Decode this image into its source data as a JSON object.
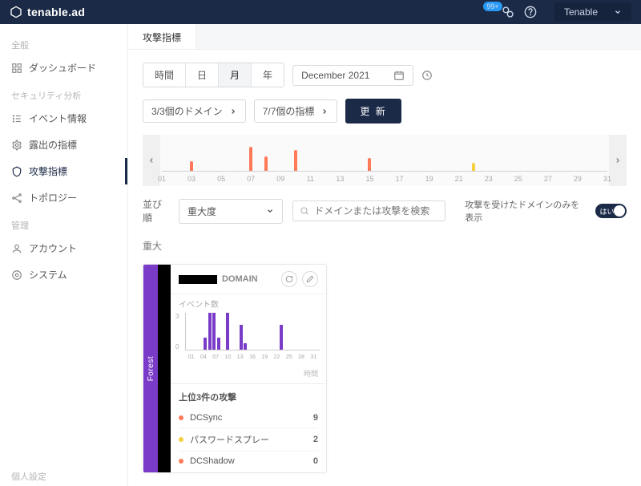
{
  "product": "tenable.ad",
  "badge": "99+",
  "tenant": "Tenable",
  "sidebar": {
    "groups": [
      {
        "label": "全般",
        "items": [
          {
            "label": "ダッシュボード",
            "icon": "grid"
          }
        ]
      },
      {
        "label": "セキュリティ分析",
        "items": [
          {
            "label": "イベント情報",
            "icon": "list"
          },
          {
            "label": "露出の指標",
            "icon": "gear"
          },
          {
            "label": "攻撃指標",
            "icon": "shield",
            "active": true
          },
          {
            "label": "トポロジー",
            "icon": "topology"
          }
        ]
      },
      {
        "label": "管理",
        "items": [
          {
            "label": "アカウント",
            "icon": "user"
          },
          {
            "label": "システム",
            "icon": "circle"
          }
        ]
      },
      {
        "label": "個人設定",
        "items": []
      }
    ]
  },
  "tab": "攻撃指標",
  "time_btns": [
    "時間",
    "日",
    "月",
    "年"
  ],
  "time_selected": "月",
  "date_value": "December 2021",
  "domain_chip": "3/3個のドメイン",
  "indicator_chip": "7/7個の指標",
  "update_btn": "更 新",
  "timeline": {
    "ticks": [
      "01",
      "03",
      "05",
      "07",
      "09",
      "11",
      "13",
      "15",
      "17",
      "19",
      "21",
      "23",
      "25",
      "27",
      "29",
      "31"
    ],
    "bars": [
      {
        "day": 3,
        "h": 12,
        "color": "#ff7a59"
      },
      {
        "day": 7,
        "h": 30,
        "color": "#ff7a59"
      },
      {
        "day": 8,
        "h": 18,
        "color": "#ff7a59"
      },
      {
        "day": 10,
        "h": 26,
        "color": "#ff7a59"
      },
      {
        "day": 15,
        "h": 16,
        "color": "#ff7a59"
      },
      {
        "day": 22,
        "h": 10,
        "color": "#f4d03f"
      }
    ]
  },
  "sort_label": "並び順",
  "sort_value": "重大度",
  "search_placeholder": "ドメインまたは攻撃を検索",
  "attacked_only_label": "攻撃を受けたドメインのみを表示",
  "toggle_text": "はい",
  "severity_heading": "重大",
  "card": {
    "forest": "Forest",
    "domain_suffix": "DOMAIN",
    "event_count_label": "イベント数",
    "time_label": "時間",
    "top3_title": "上位3件の攻撃",
    "attacks": [
      {
        "name": "DCSync",
        "count": 9,
        "color": "#ff7a59"
      },
      {
        "name": "パスワードスプレー",
        "count": 2,
        "color": "#f4d03f"
      },
      {
        "name": "DCShadow",
        "count": 0,
        "color": "#ff7a59"
      }
    ]
  },
  "chart_data": {
    "type": "bar",
    "title": "イベント数",
    "xlabel": "時間",
    "ylim": [
      0,
      3
    ],
    "categories": [
      "01",
      "04",
      "07",
      "10",
      "13",
      "16",
      "19",
      "22",
      "25",
      "28",
      "31"
    ],
    "values_by_day": [
      {
        "day": 5,
        "v": 1
      },
      {
        "day": 6,
        "v": 3
      },
      {
        "day": 7,
        "v": 3
      },
      {
        "day": 8,
        "v": 1
      },
      {
        "day": 10,
        "v": 3
      },
      {
        "day": 13,
        "v": 2
      },
      {
        "day": 14,
        "v": 0.5
      },
      {
        "day": 22,
        "v": 2
      }
    ]
  }
}
